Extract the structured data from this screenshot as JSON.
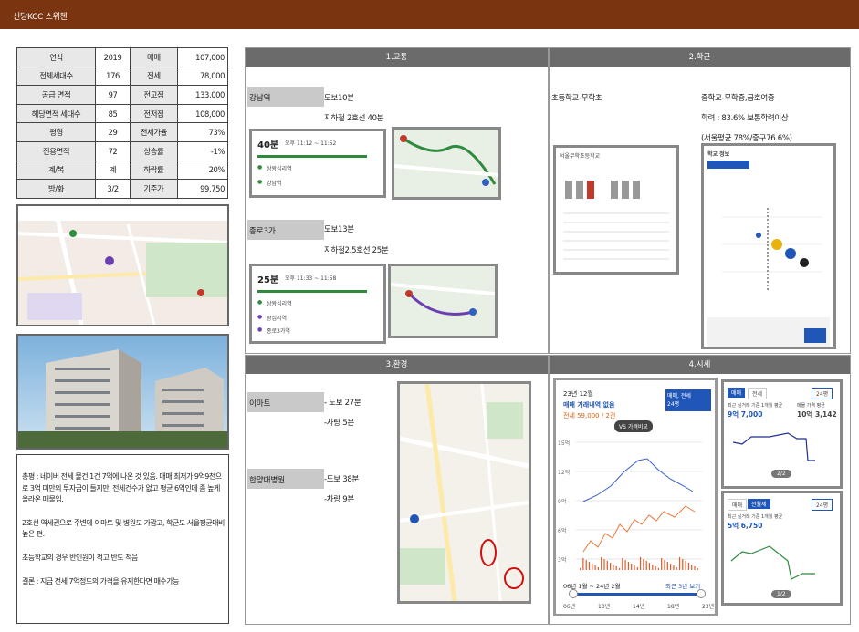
{
  "header": {
    "title": "신당KCC 스위첸"
  },
  "info_table": [
    [
      "연식",
      "2019",
      "매매",
      "107,000"
    ],
    [
      "전체세대수",
      "176",
      "전세",
      "78,000"
    ],
    [
      "공급 면적",
      "97",
      "전고점",
      "133,000"
    ],
    [
      "해당면적 세대수",
      "85",
      "전저점",
      "108,000"
    ],
    [
      "평형",
      "29",
      "전세가율",
      "73%"
    ],
    [
      "전용면적",
      "72",
      "상승률",
      "-1%"
    ],
    [
      "계/복",
      "계",
      "하락률",
      "20%"
    ],
    [
      "방/화",
      "3/2",
      "기준가",
      "99,750"
    ]
  ],
  "summary": [
    "총평 : 네이버 전세 물건 1건 7억에 나온 것 있음. 매매 최저가 9억9천으로 3억 미만의 투자금이 들지만, 전세건수가 없고 평균 6억인데 좀 높게 올라온 매물임.",
    "2호선 역세권으로 주변에 이마트 및 병원도 가깝고, 학군도 서울평균대비 높은 편.",
    "초등학교의 경우 반인원이 적고 반도 적음",
    "결론 : 지금 전세 7억정도의 가격을 유지한다면 매수가능"
  ],
  "traffic": {
    "title": "1.교통",
    "stations": [
      {
        "name": "강남역",
        "walk": "도보10분",
        "route": "지하철 2호선 40분",
        "card_time": "40분",
        "card_sub": "오후 11:12 ~ 11:52",
        "stop1": "상왕십리역",
        "stop2": "강남역"
      },
      {
        "name": "종로3가",
        "walk": "도보13분",
        "route": "지하철2.5호선 25분",
        "card_time": "25분",
        "card_sub": "오후 11:33 ~ 11:58",
        "stop1": "상왕십리역",
        "stop2": "왕십리역",
        "stop3": "종로3가역"
      }
    ]
  },
  "school": {
    "title": "2.학군",
    "elementary": "초등학교-무학초",
    "middle": "중학교-무학중,금호여중",
    "score": "학력 : 83.6% 보통학력이상",
    "avg": "(서울평균 78%/중구76.6%)",
    "card1_title": "서울무학초등학교",
    "card2_title": "학교 정보"
  },
  "env": {
    "title": "3.환경",
    "items": [
      {
        "name": "이마트",
        "walk": "- 도보 27분",
        "car": "-차량 5분"
      },
      {
        "name": "한양대병원",
        "walk": "-도보 38분",
        "car": "-차량 9분"
      }
    ]
  },
  "price": {
    "title": "4.시세",
    "month": "23년 12월",
    "subtitle": "매매 거래내역 없음",
    "jeonse": "전세 59,000 / 2건",
    "toggle": "매매, 전세",
    "toggle2": "24평",
    "compare": "VS 가격비교",
    "range": "06년 1월 ~ 24년 2월",
    "range_btn": "최근 3년 보기",
    "x_ticks": [
      "06년",
      "10년",
      "14년",
      "18년",
      "23년"
    ],
    "y_ticks": [
      "15억",
      "12억",
      "9억",
      "6억",
      "3억"
    ],
    "side1": {
      "tabs": [
        "매매",
        "전세"
      ],
      "size": "24평",
      "label": "최근 실거래 기준 1개월 평균",
      "value": "9억 7,000",
      "label2": "매물 가격 평균",
      "value2": "10억 3,142",
      "page": "2/2"
    },
    "side2": {
      "tabs": [
        "매매",
        "전월세"
      ],
      "size": "24평",
      "label": "최근 실거래 기준 1개월 평균",
      "value": "5억 6,750",
      "page": "1/2"
    }
  }
}
